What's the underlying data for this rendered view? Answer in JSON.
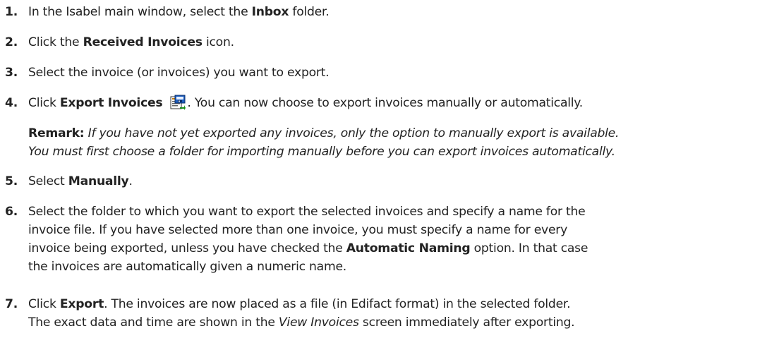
{
  "steps": [
    {
      "num": "1.",
      "pre": "In the Isabel main window, select the ",
      "bold": "Inbox",
      "post": " folder."
    },
    {
      "num": "2.",
      "pre": "Click the ",
      "bold": "Received Invoices",
      "post": " icon."
    },
    {
      "num": "3.",
      "text": "Select the invoice (or invoices) you want to export."
    },
    {
      "num": "4.",
      "pre": "Click ",
      "bold": "Export Invoices",
      "post": ". You can now choose to export invoices manually or automatically.",
      "icon": "export-invoices-icon"
    },
    {
      "num": "5.",
      "pre": "Select ",
      "bold": "Manually",
      "post": "."
    },
    {
      "num": "6.",
      "line1": "Select the folder to which you want to export the selected invoices and specify a name for the",
      "line2": "invoice file. If you have selected more than one invoice, you must specify a name for every",
      "line3_pre": "invoice being exported, unless you have checked the ",
      "line3_bold": "Automatic Naming",
      "line3_post": " option. In that case",
      "line4": "the invoices are automatically given a numeric name."
    },
    {
      "num": "7.",
      "pre": "Click ",
      "bold": "Export",
      "post": ". The invoices are now placed as a file (in Edifact format) in the selected folder.",
      "line2_pre": "The exact data and time are shown in the ",
      "line2_italic": "View Invoices",
      "line2_post": " screen immediately after exporting."
    }
  ],
  "remark": {
    "label": "Remark:",
    "line1": "If you have not yet exported any invoices, only the option to manually export is available.",
    "line2": "You must first choose a folder for importing manually before you can export invoices automatically."
  }
}
